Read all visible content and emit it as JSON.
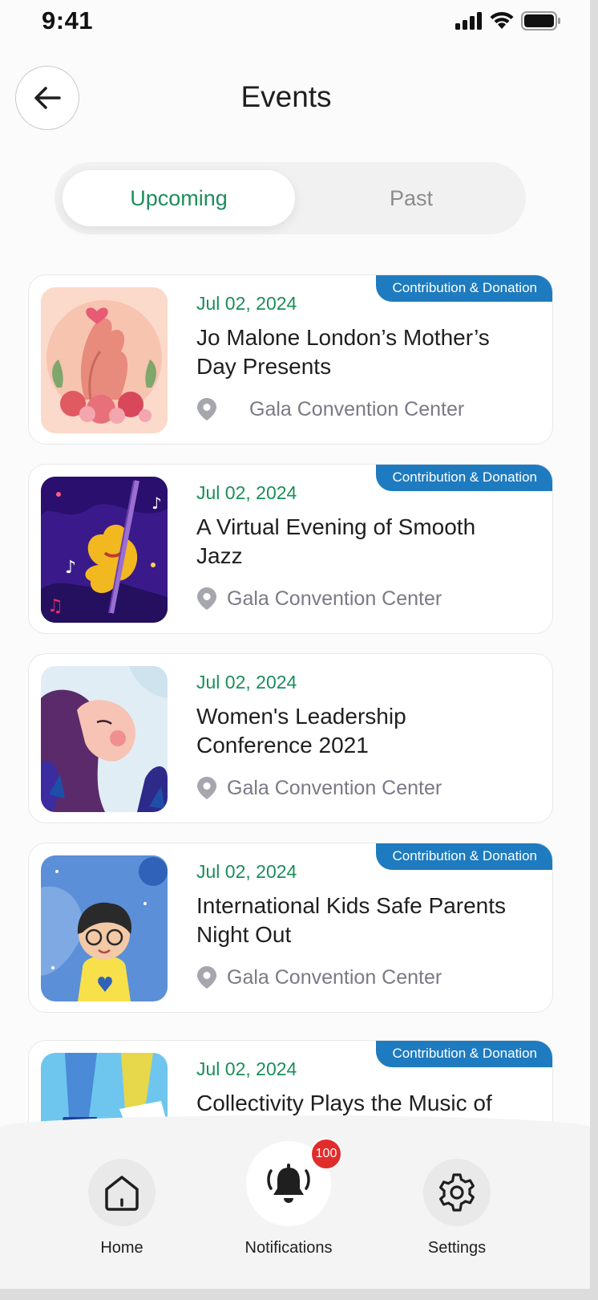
{
  "status_bar": {
    "time": "9:41"
  },
  "header": {
    "title": "Events"
  },
  "tabs": [
    {
      "label": "Upcoming",
      "active": true
    },
    {
      "label": "Past",
      "active": false
    }
  ],
  "events": [
    {
      "date": "Jul 02, 2024",
      "title": "Jo Malone London’s Mother’s Day Presents",
      "location": "Gala Convention Center",
      "badge": "Contribution & Donation"
    },
    {
      "date": "Jul 02, 2024",
      "title": "A Virtual Evening of Smooth Jazz",
      "location": "Gala Convention Center",
      "badge": "Contribution & Donation"
    },
    {
      "date": "Jul 02, 2024",
      "title": "Women's Leadership Conference 2021",
      "location": "Gala Convention Center",
      "badge": ""
    },
    {
      "date": "Jul 02, 2024",
      "title": "International Kids Safe Parents Night Out",
      "location": "Gala Convention Center",
      "badge": "Contribution & Donation"
    },
    {
      "date": "Jul 02, 2024",
      "title": "Collectivity Plays the Music of",
      "location": "",
      "badge": "Contribution & Donation"
    }
  ],
  "bottom_nav": {
    "home": "Home",
    "notifications": "Notifications",
    "notifications_count": "100",
    "settings": "Settings"
  },
  "colors": {
    "accent_green": "#1b8e5a",
    "badge_blue": "#1e7bbf",
    "notification_red": "#e12c2c"
  }
}
